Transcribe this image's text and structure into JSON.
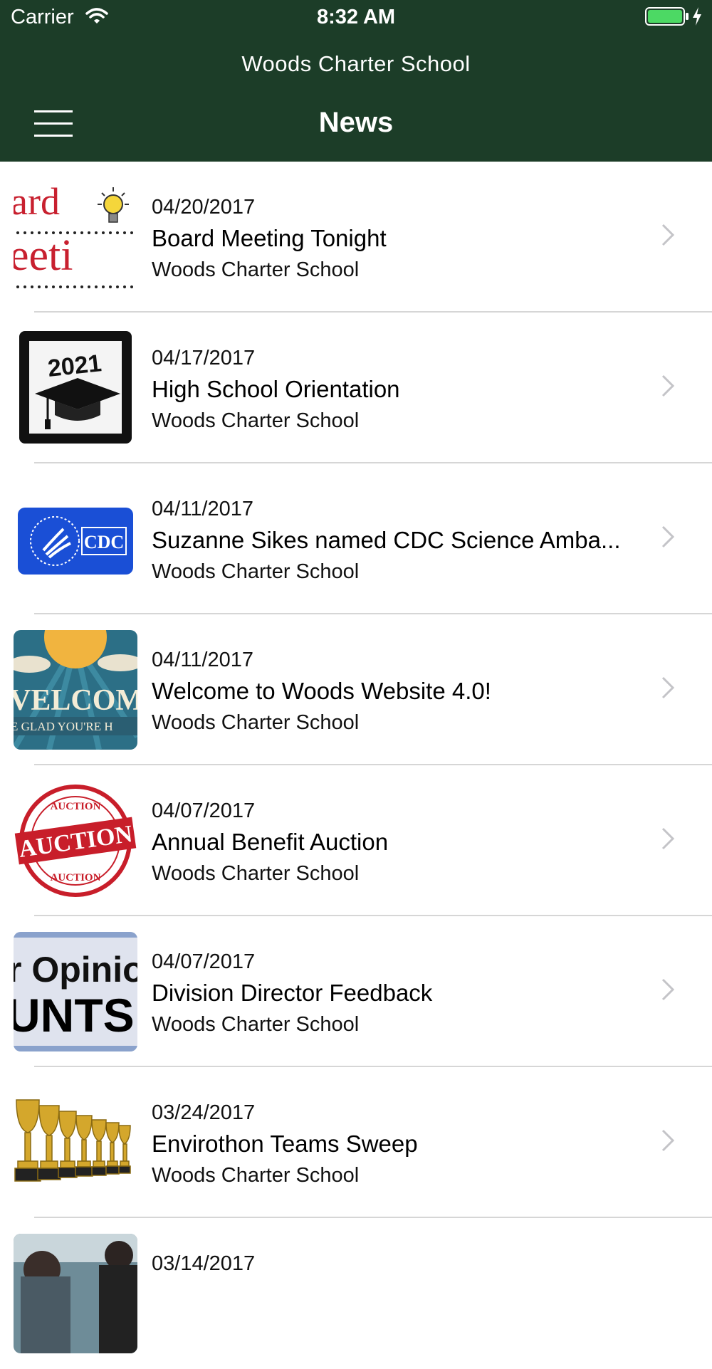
{
  "status_bar": {
    "carrier": "Carrier",
    "time": "8:32 AM"
  },
  "header": {
    "school": "Woods Charter School",
    "title": "News"
  },
  "colors": {
    "header_bg": "#1c3d28",
    "divider": "#d6d6d6",
    "battery": "#4cd964"
  },
  "news": [
    {
      "date": "04/20/2017",
      "title": "Board Meeting Tonight",
      "source": "Woods Charter School",
      "thumb_text": [
        "ard",
        "eeti"
      ]
    },
    {
      "date": "04/17/2017",
      "title": "High School Orientation",
      "source": "Woods Charter School",
      "thumb_text": [
        "2021"
      ]
    },
    {
      "date": "04/11/2017",
      "title": "Suzanne Sikes named CDC Science Amba...",
      "source": "Woods Charter School",
      "thumb_text": [
        "CDC"
      ]
    },
    {
      "date": "04/11/2017",
      "title": "Welcome to Woods Website 4.0!",
      "source": "Woods Charter School",
      "thumb_text": [
        "VELCOM",
        "E GLAD YOU'RE H"
      ]
    },
    {
      "date": "04/07/2017",
      "title": "Annual Benefit Auction",
      "source": "Woods Charter School",
      "thumb_text": [
        "AUCTION",
        "AUCTION",
        "AUCTION"
      ]
    },
    {
      "date": "04/07/2017",
      "title": "Division Director Feedback",
      "source": "Woods Charter School",
      "thumb_text": [
        "r Opinio",
        "UNTS"
      ]
    },
    {
      "date": "03/24/2017",
      "title": " Envirothon Teams Sweep",
      "source": "Woods Charter School",
      "thumb_text": []
    },
    {
      "date": "03/14/2017",
      "title": "",
      "source": "",
      "thumb_text": []
    }
  ]
}
